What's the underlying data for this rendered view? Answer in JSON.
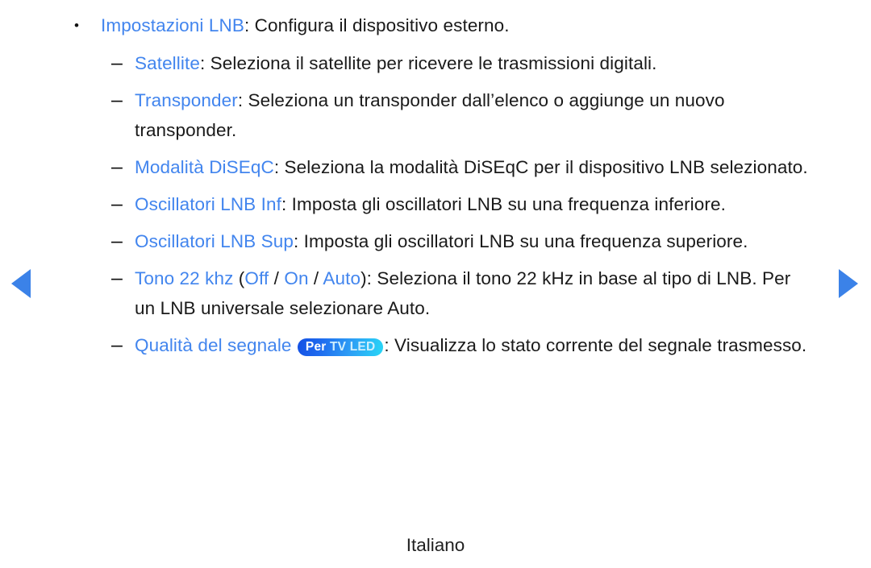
{
  "theme": {
    "keyword_color": "#4285ee",
    "text_color": "#1a1a1a",
    "arrow_color": "#3b82e8",
    "badge_gradient_start": "#1450e4",
    "badge_gradient_end": "#27d7f6",
    "background": "#ffffff"
  },
  "nav": {
    "prev_label": "◀",
    "prev_name": "previous-page-arrow",
    "next_label": "▶",
    "next_name": "next-page-arrow"
  },
  "markers": {
    "bullet": "•",
    "dash": "–"
  },
  "badge": {
    "prefix": "Per",
    "mid": "TV",
    "suffix": "LED",
    "full_text": "Per TV LED"
  },
  "items": [
    {
      "level": 1,
      "keyword": "Impostazioni LNB",
      "description": ": Configura il dispositivo esterno."
    },
    {
      "level": 2,
      "keyword": "Satellite",
      "description": ": Seleziona il satellite per ricevere le trasmissioni digitali."
    },
    {
      "level": 2,
      "keyword": "Transponder",
      "description": ": Seleziona un transponder dall’elenco o aggiunge un nuovo transponder."
    },
    {
      "level": 2,
      "keyword": "Modalità DiSEqC",
      "description": ": Seleziona la modalità DiSEqC per il dispositivo LNB selezionato."
    },
    {
      "level": 2,
      "keyword": "Oscillatori LNB Inf",
      "description": ": Imposta gli oscillatori LNB su una frequenza inferiore."
    },
    {
      "level": 2,
      "keyword": "Oscillatori LNB Sup",
      "description": ": Imposta gli oscillatori LNB su una frequenza superiore."
    },
    {
      "level": 2,
      "keyword": "Tono 22 khz",
      "options_open": " (",
      "option1": "Off",
      "sep1": " / ",
      "option2": "On",
      "sep2": " / ",
      "option3": "Auto",
      "options_close": ")",
      "description": ": Seleziona il tono 22 kHz in base al tipo di LNB. Per un LNB universale selezionare Auto."
    },
    {
      "level": 2,
      "keyword": "Qualità del segnale",
      "description": ": Visualizza lo stato corrente del segnale trasmesso."
    }
  ],
  "footer": {
    "language": "Italiano"
  }
}
